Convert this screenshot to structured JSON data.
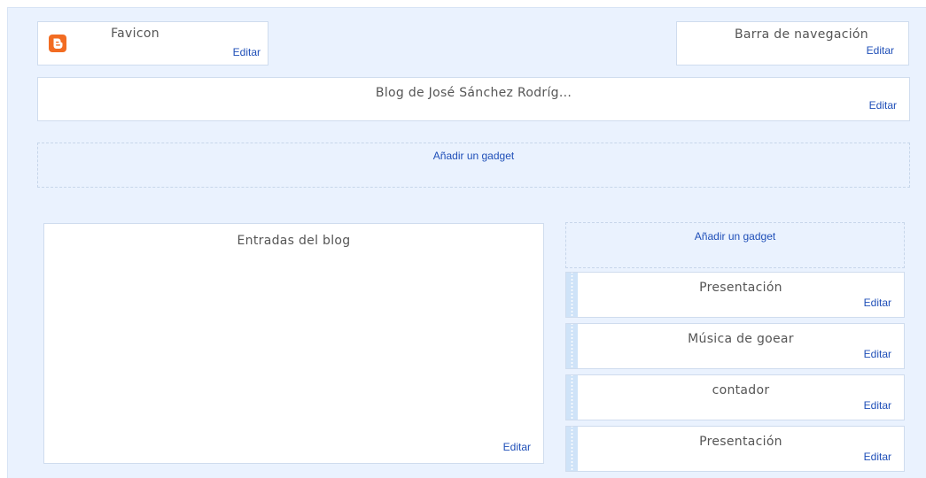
{
  "favicon": {
    "icon": "blogger-icon",
    "title": "Favicon",
    "edit": "Editar"
  },
  "navbar": {
    "title": "Barra de navegación",
    "edit": "Editar"
  },
  "header": {
    "title": "Blog de José Sánchez Rodríg...",
    "edit": "Editar"
  },
  "top_add": {
    "label": "Añadir un gadget"
  },
  "main": {
    "title": "Entradas del blog",
    "edit": "Editar"
  },
  "sidebar": {
    "add_label": "Añadir un gadget",
    "gadgets": [
      {
        "title": "Presentación",
        "edit": "Editar"
      },
      {
        "title": "Música de goear",
        "edit": "Editar"
      },
      {
        "title": "contador",
        "edit": "Editar"
      },
      {
        "title": "Presentación",
        "edit": "Editar"
      }
    ]
  },
  "colors": {
    "accent": "#1f4fb8",
    "background": "#eaf2fe",
    "blogger_orange": "#f26c22"
  }
}
